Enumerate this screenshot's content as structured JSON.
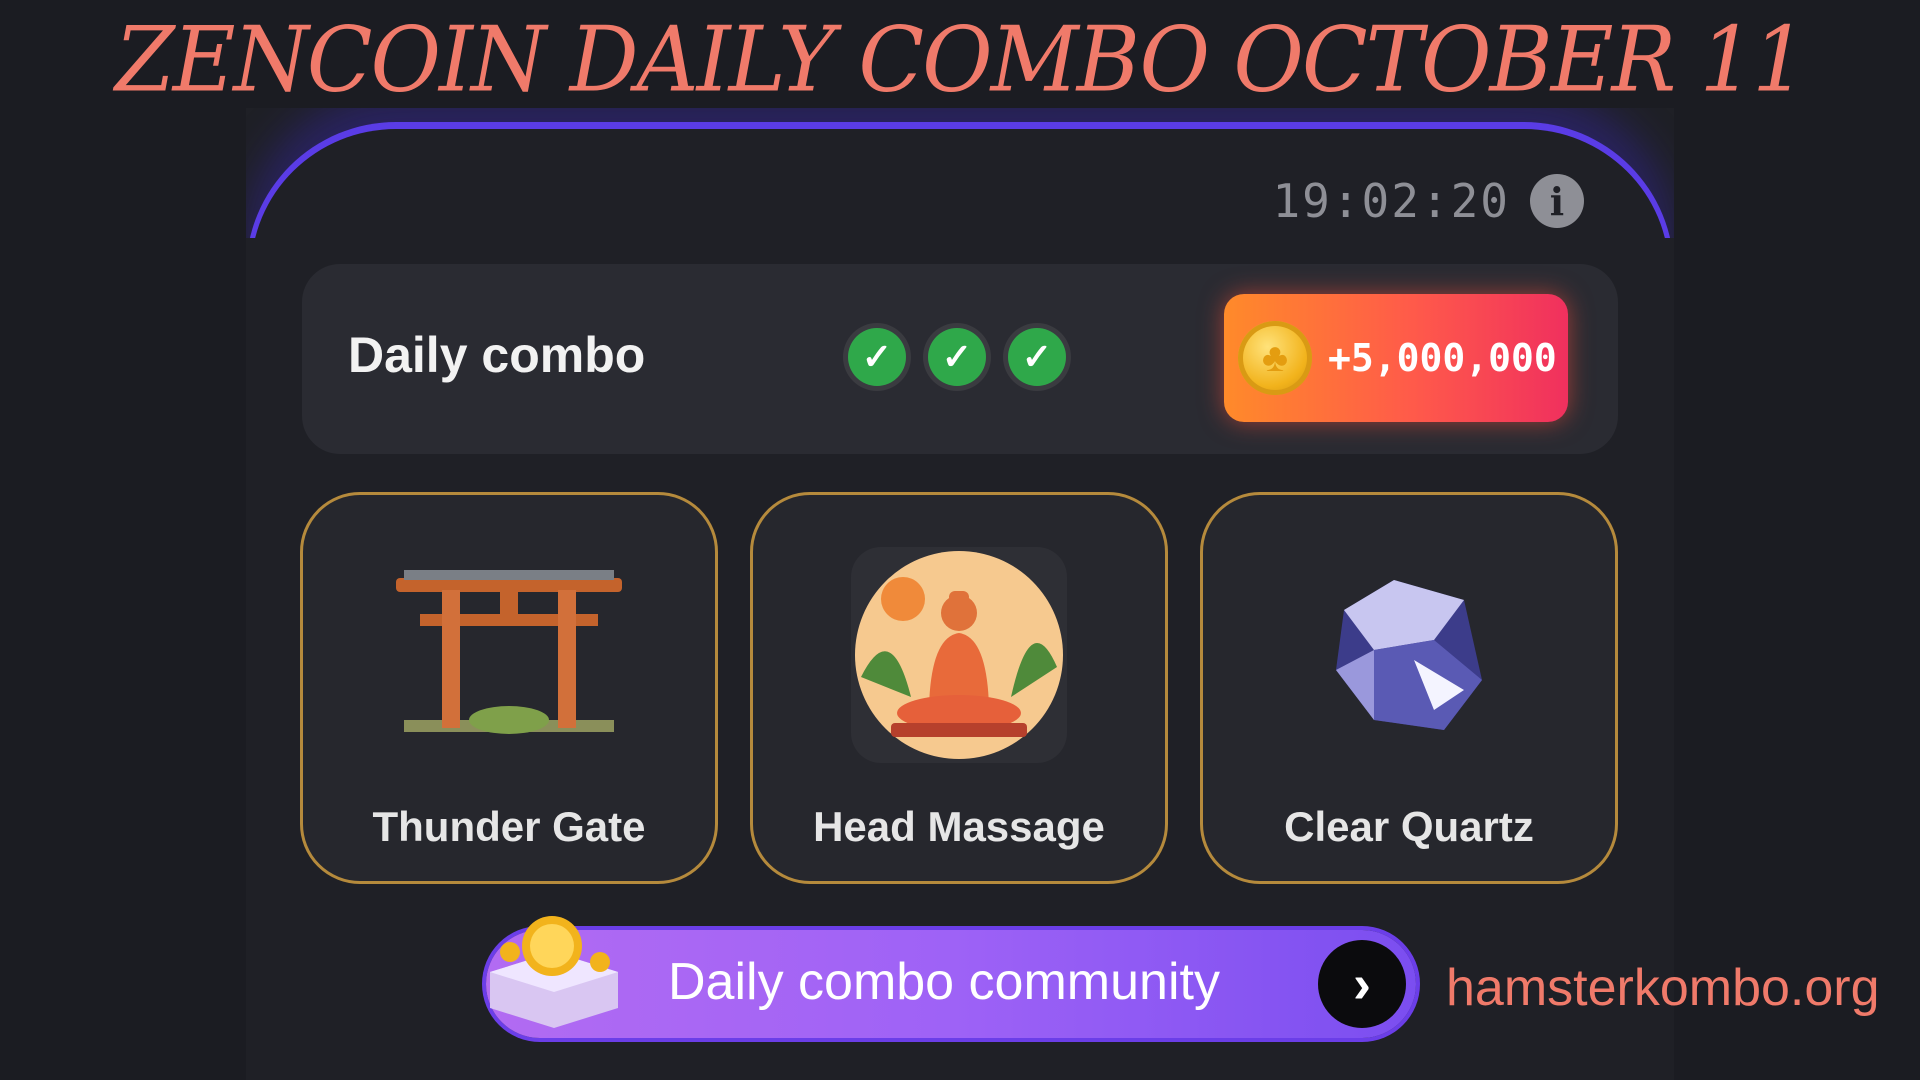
{
  "headline": "ZENCOIN DAILY COMBO OCTOBER 11",
  "timer": "19:02:20",
  "combo": {
    "title": "Daily combo",
    "checks_completed": 3,
    "reward": "+5,000,000"
  },
  "cards": [
    {
      "label": "Thunder Gate",
      "icon": "torii-gate-icon"
    },
    {
      "label": "Head Massage",
      "icon": "meditation-icon"
    },
    {
      "label": "Clear Quartz",
      "icon": "crystal-icon"
    }
  ],
  "community": {
    "label": "Daily combo community"
  },
  "site": "hamsterkombo.org",
  "colors": {
    "accent_salmon": "#f07a6a",
    "reward_gradient_start": "#ff8a2a",
    "reward_gradient_end": "#f0305e",
    "banner_purple": "#9e62f6",
    "check_green": "#2fa84a"
  }
}
